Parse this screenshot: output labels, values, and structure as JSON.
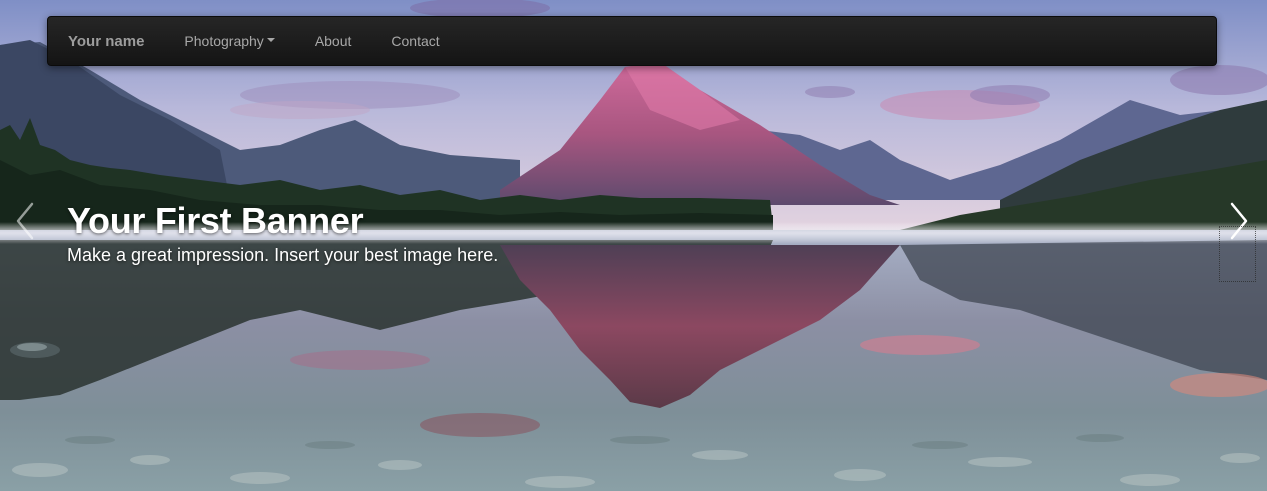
{
  "navbar": {
    "brand": "Your name",
    "items": [
      {
        "label": "Photography",
        "dropdown": true
      },
      {
        "label": "About",
        "dropdown": false
      },
      {
        "label": "Contact",
        "dropdown": false
      }
    ]
  },
  "banner": {
    "title": "Your First Banner",
    "subtitle": "Make a great impression. Insert your best image here."
  },
  "controls": {
    "prev_icon": "chevron-left-icon",
    "next_icon": "chevron-right-icon"
  },
  "colors": {
    "navbar_bg": "#1b1b1b",
    "nav_text": "#a8a8a8",
    "caption_text": "#ffffff"
  }
}
